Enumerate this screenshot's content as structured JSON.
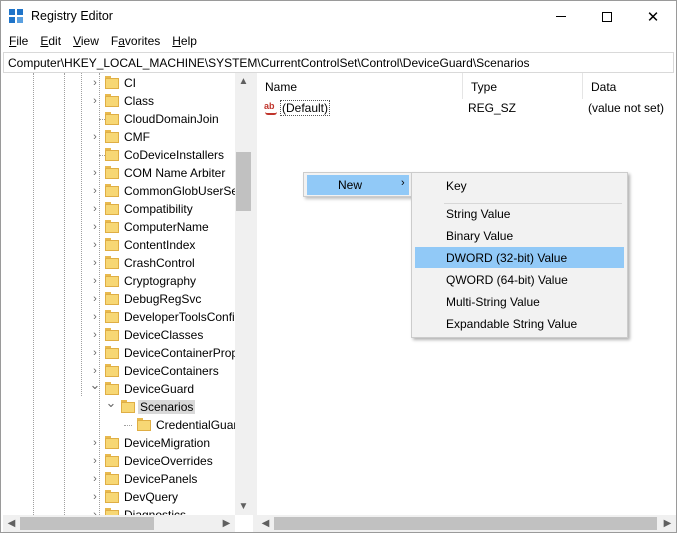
{
  "window": {
    "title": "Registry Editor"
  },
  "menu": [
    {
      "key": "F",
      "rest": "ile"
    },
    {
      "key": "E",
      "rest": "dit"
    },
    {
      "key": "V",
      "rest": "iew"
    },
    {
      "key": "",
      "rest": "Favorites",
      "underline_index": 1
    },
    {
      "key": "H",
      "rest": "elp"
    }
  ],
  "menu_labels": {
    "file": "File",
    "edit": "Edit",
    "view": "View",
    "favorites": "Favorites",
    "help": "Help"
  },
  "address": "Computer\\HKEY_LOCAL_MACHINE\\SYSTEM\\CurrentControlSet\\Control\\DeviceGuard\\Scenarios",
  "tree": {
    "items": [
      {
        "label": "CI",
        "expand": "collapsed"
      },
      {
        "label": "Class",
        "expand": "collapsed"
      },
      {
        "label": "CloudDomainJoin",
        "expand": "none"
      },
      {
        "label": "CMF",
        "expand": "collapsed"
      },
      {
        "label": "CoDeviceInstallers",
        "expand": "none"
      },
      {
        "label": "COM Name Arbiter",
        "expand": "collapsed"
      },
      {
        "label": "CommonGlobUserSe",
        "expand": "collapsed"
      },
      {
        "label": "Compatibility",
        "expand": "collapsed"
      },
      {
        "label": "ComputerName",
        "expand": "collapsed"
      },
      {
        "label": "ContentIndex",
        "expand": "collapsed"
      },
      {
        "label": "CrashControl",
        "expand": "collapsed"
      },
      {
        "label": "Cryptography",
        "expand": "collapsed"
      },
      {
        "label": "DebugRegSvc",
        "expand": "collapsed"
      },
      {
        "label": "DeveloperToolsConfi",
        "expand": "collapsed"
      },
      {
        "label": "DeviceClasses",
        "expand": "collapsed"
      },
      {
        "label": "DeviceContainerProp",
        "expand": "collapsed"
      },
      {
        "label": "DeviceContainers",
        "expand": "collapsed"
      },
      {
        "label": "DeviceGuard",
        "expand": "expanded"
      },
      {
        "label": "Scenarios",
        "expand": "expanded",
        "selected": true
      },
      {
        "label": "CredentialGuar",
        "expand": "none"
      },
      {
        "label": "DeviceMigration",
        "expand": "collapsed"
      },
      {
        "label": "DeviceOverrides",
        "expand": "collapsed"
      },
      {
        "label": "DevicePanels",
        "expand": "collapsed"
      },
      {
        "label": "DevQuery",
        "expand": "collapsed"
      },
      {
        "label": "Diagnostics",
        "expand": "collapsed"
      }
    ]
  },
  "list": {
    "columns": [
      "Name",
      "Type",
      "Data"
    ],
    "rows": [
      {
        "name": "(Default)",
        "type": "REG_SZ",
        "data": "(value not set)"
      }
    ]
  },
  "context_menu": {
    "parent": {
      "label": "New",
      "arrow": "›"
    },
    "submenu": [
      {
        "label": "Key"
      },
      {
        "label": "String Value"
      },
      {
        "label": "Binary Value"
      },
      {
        "label": "DWORD (32-bit) Value",
        "highlighted": true
      },
      {
        "label": "QWORD (64-bit) Value"
      },
      {
        "label": "Multi-String Value"
      },
      {
        "label": "Expandable String Value"
      }
    ]
  },
  "colors": {
    "highlight": "#91c9f7",
    "folder": "#f7d774",
    "menu_bg": "#f2f2f2",
    "selection": "#d9d9d9"
  }
}
